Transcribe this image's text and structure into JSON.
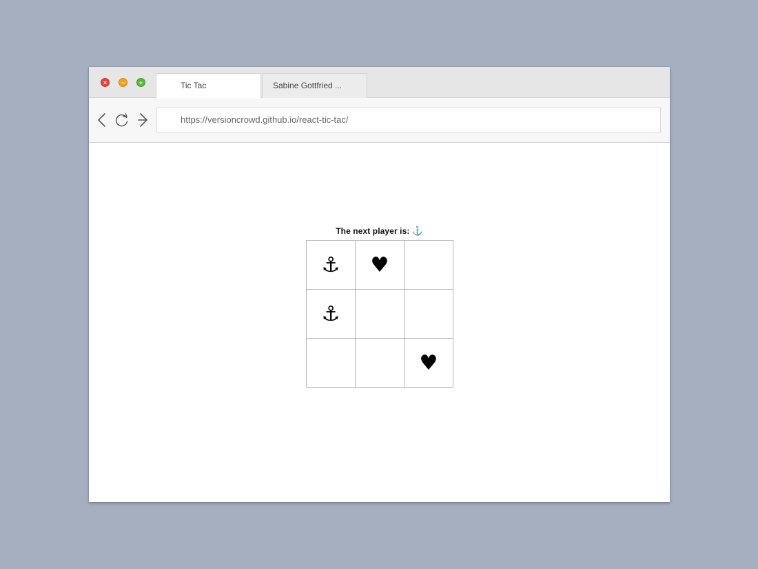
{
  "window": {
    "tabs": [
      {
        "label": "Tic Tac",
        "active": true
      },
      {
        "label": "Sabine Gottfried ...",
        "active": false
      }
    ],
    "url": "https://versioncrowd.github.io/react-tic-tac/"
  },
  "game": {
    "status_label": "The next player is:",
    "next_player": "⚓",
    "board": [
      [
        "⚓",
        "♥",
        ""
      ],
      [
        "⚓",
        "",
        ""
      ],
      [
        "",
        "",
        "♥"
      ]
    ]
  },
  "colors": {
    "background": "#a5afc0",
    "close": "#e2463d",
    "minimize": "#f0a21c",
    "maximize": "#5ab838"
  },
  "icons": {
    "back": "arrow-left-icon",
    "reload": "reload-icon",
    "forward": "arrow-right-icon"
  }
}
